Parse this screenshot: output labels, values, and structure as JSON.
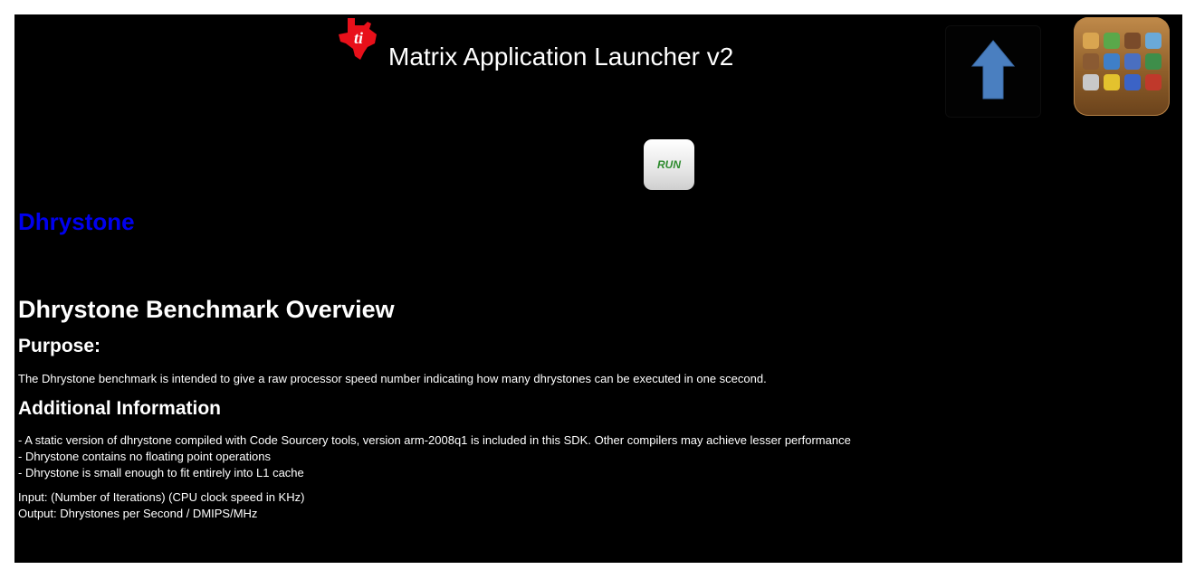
{
  "header": {
    "title": "Matrix Application Launcher v2",
    "logo_icon": "ti-logo-icon",
    "up_icon": "up-arrow-icon",
    "apps_icon": "app-grid-icon"
  },
  "run_button": {
    "label": "RUN"
  },
  "app": {
    "name": "Dhrystone"
  },
  "content": {
    "heading": "Dhrystone Benchmark Overview",
    "purpose_heading": "Purpose:",
    "purpose_text": "The Dhrystone benchmark is intended to give a raw processor speed number indicating how many dhrystones can be executed in one scecond.",
    "info_heading": "Additional Information",
    "info_items": [
      "- A static version of dhrystone compiled with Code Sourcery tools, version arm-2008q1 is included in this SDK. Other compilers may achieve lesser performance",
      "- Dhrystone contains no floating point operations",
      "- Dhrystone is small enough to fit entirely into L1 cache"
    ],
    "input_text": "Input: (Number of Iterations) (CPU clock speed in KHz)",
    "output_text": "Output: Dhrystones per Second / DMIPS/MHz"
  },
  "colors": {
    "background": "#000000",
    "app_name": "#0000ee",
    "logo": "#e8101a",
    "up_arrow": "#4a7fc0",
    "run_text": "#2e8b2e"
  }
}
